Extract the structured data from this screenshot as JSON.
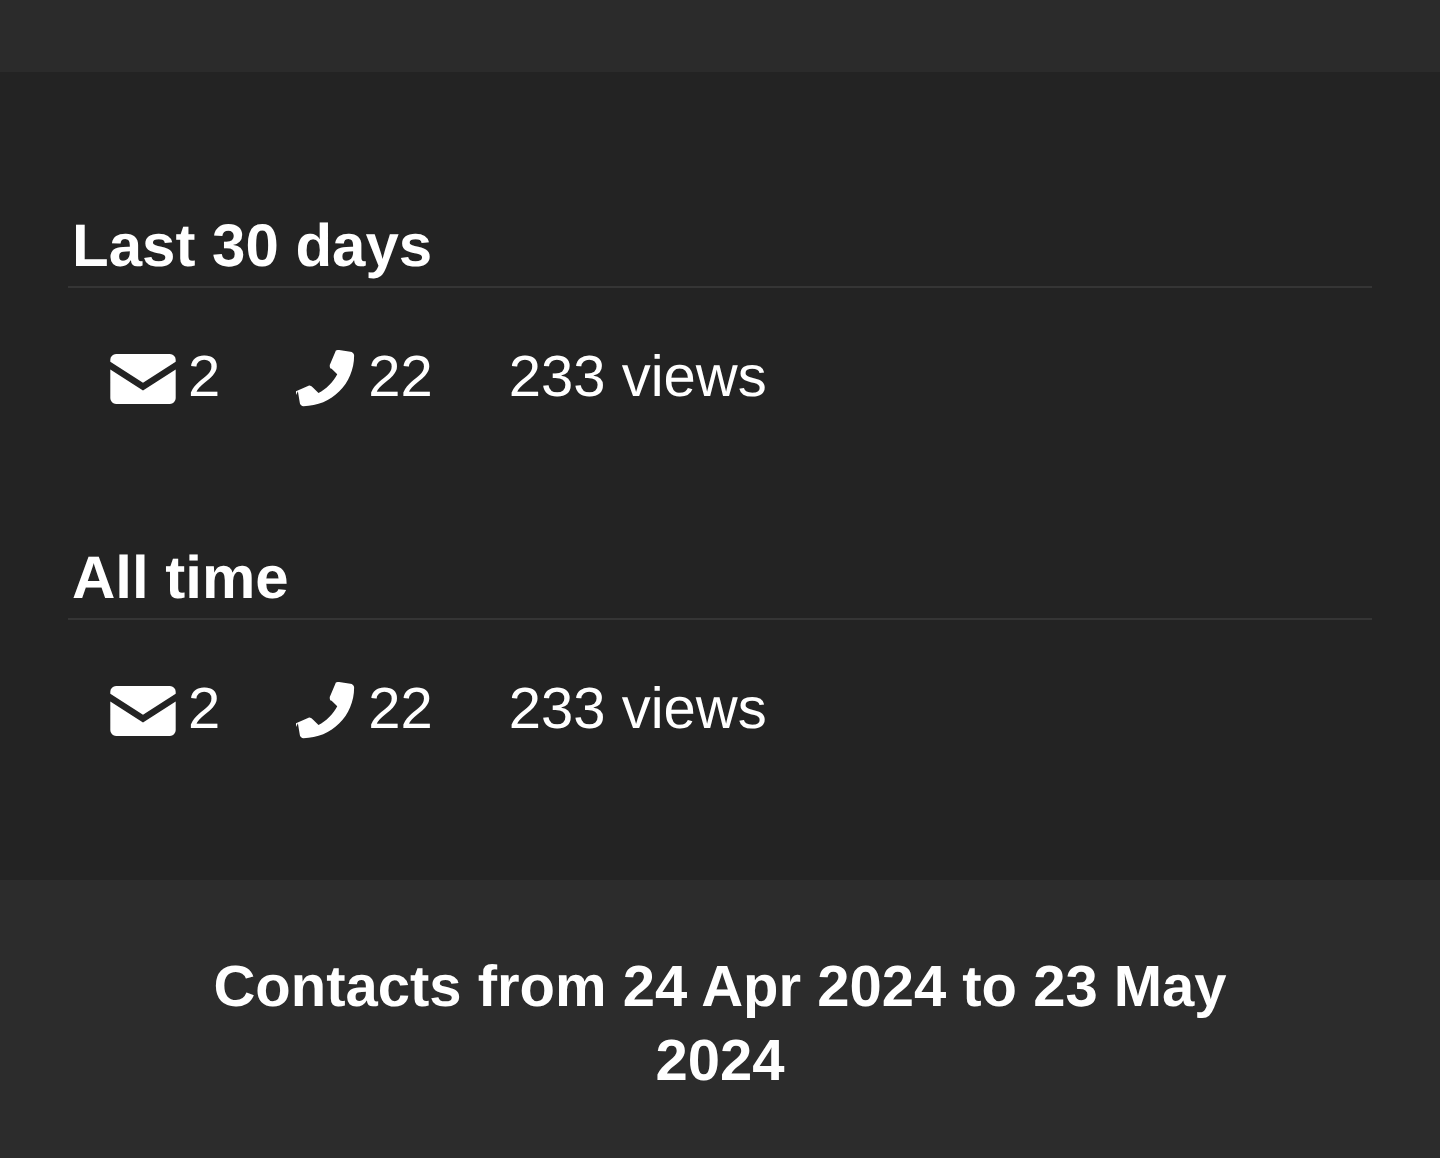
{
  "sections": [
    {
      "title": "Last 30 days",
      "messages": "2",
      "calls": "22",
      "views": "233 views"
    },
    {
      "title": "All time",
      "messages": "2",
      "calls": "22",
      "views": "233 views"
    }
  ],
  "footer": "Contacts from 24 Apr 2024 to 23 May 2024"
}
